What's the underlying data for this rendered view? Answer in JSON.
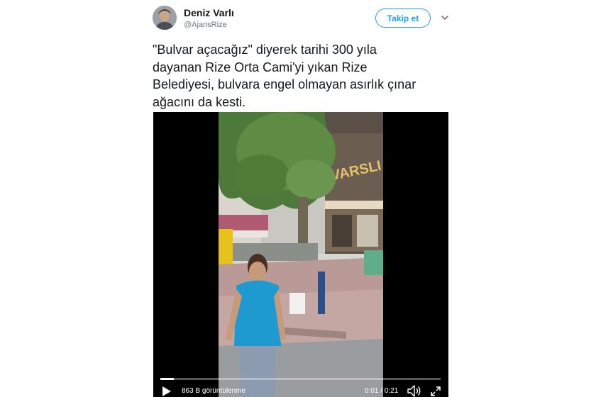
{
  "tweet": {
    "author_name": "Deniz Varlı",
    "author_handle": "@AjansRize",
    "follow_label": "Takip et",
    "text": "\"Bulvar açacağız\" diyerek tarihi 300 yıla\ndayanan Rize Orta Cami'yi yıkan Rize\nBelediyesi, bulvara engel olmayan asırlık çınar\nağacını da kesti."
  },
  "video": {
    "views": "863 B görüntülenme",
    "time": "0:01 / 0:21",
    "progress": 0.048,
    "shop_sign": "VARSLI"
  },
  "colors": {
    "accent": "#1da1f2",
    "text": "#14171a",
    "muted": "#657786"
  },
  "icons": [
    "chevron-down-icon",
    "play-icon",
    "volume-icon",
    "fullscreen-icon"
  ]
}
